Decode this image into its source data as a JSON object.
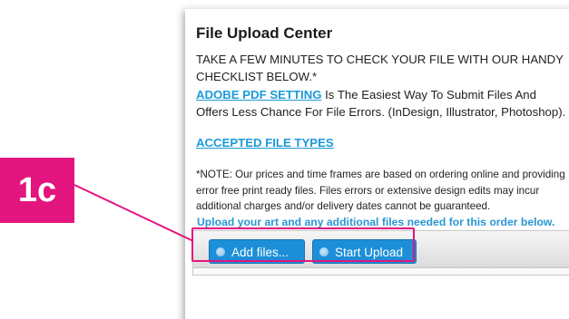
{
  "callout": {
    "badge_label": "1c",
    "accent_color": "#e3157e"
  },
  "panel": {
    "title": "File Upload Center",
    "intro": "TAKE A FEW MINUTES TO CHECK YOUR FILE WITH OUR HANDY CHECKLIST BELOW.*",
    "pdf_link": "ADOBE PDF SETTING",
    "pdf_text": " Is The Easiest Way To Submit Files And Offers Less Chance For File Errors. (InDesign, Illustrator, Photoshop).",
    "file_types_link": "ACCEPTED FILE TYPES",
    "note": "*NOTE: Our prices and time frames are based on ordering online and providing error free print ready files. Files errors or extensive design edits may incur additional charges and/or delivery dates cannot be guaranteed.",
    "upload_hint": "Upload your art and any additional files needed for this order below.",
    "link_color": "#1c9ad8"
  },
  "uploader": {
    "add_files_label": "Add files...",
    "start_upload_label": "Start Upload",
    "button_color": "#1c8fd8",
    "button_icon": "circle-icon"
  }
}
